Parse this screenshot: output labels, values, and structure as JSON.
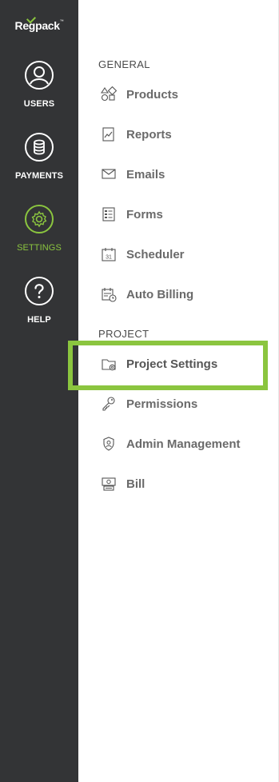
{
  "brand": {
    "logo_text": "Regpack",
    "trademark": "™",
    "accent_color": "#8bc53f"
  },
  "rail": {
    "background": "#333436",
    "items": [
      {
        "label": "USERS",
        "icon": "user-icon",
        "active": false
      },
      {
        "label": "PAYMENTS",
        "icon": "coins-icon",
        "active": false
      },
      {
        "label": "SETTINGS",
        "icon": "gear-icon",
        "active": true
      },
      {
        "label": "HELP",
        "icon": "question-icon",
        "active": false
      }
    ]
  },
  "panel": {
    "general": {
      "heading": "GENERAL",
      "items": [
        {
          "label": "Products",
          "icon": "shapes-icon"
        },
        {
          "label": "Reports",
          "icon": "chart-doc-icon"
        },
        {
          "label": "Emails",
          "icon": "envelope-icon"
        },
        {
          "label": "Forms",
          "icon": "form-icon"
        },
        {
          "label": "Scheduler",
          "icon": "calendar-icon"
        },
        {
          "label": "Auto Billing",
          "icon": "calendar-clock-icon"
        }
      ]
    },
    "project": {
      "heading": "PROJECT",
      "items": [
        {
          "label": "Project Settings",
          "icon": "folder-gear-icon",
          "selected": true
        },
        {
          "label": "Permissions",
          "icon": "key-icon"
        },
        {
          "label": "Admin Management",
          "icon": "shield-user-icon"
        },
        {
          "label": "Bill",
          "icon": "bill-icon"
        }
      ]
    },
    "calendar_day": "31"
  }
}
